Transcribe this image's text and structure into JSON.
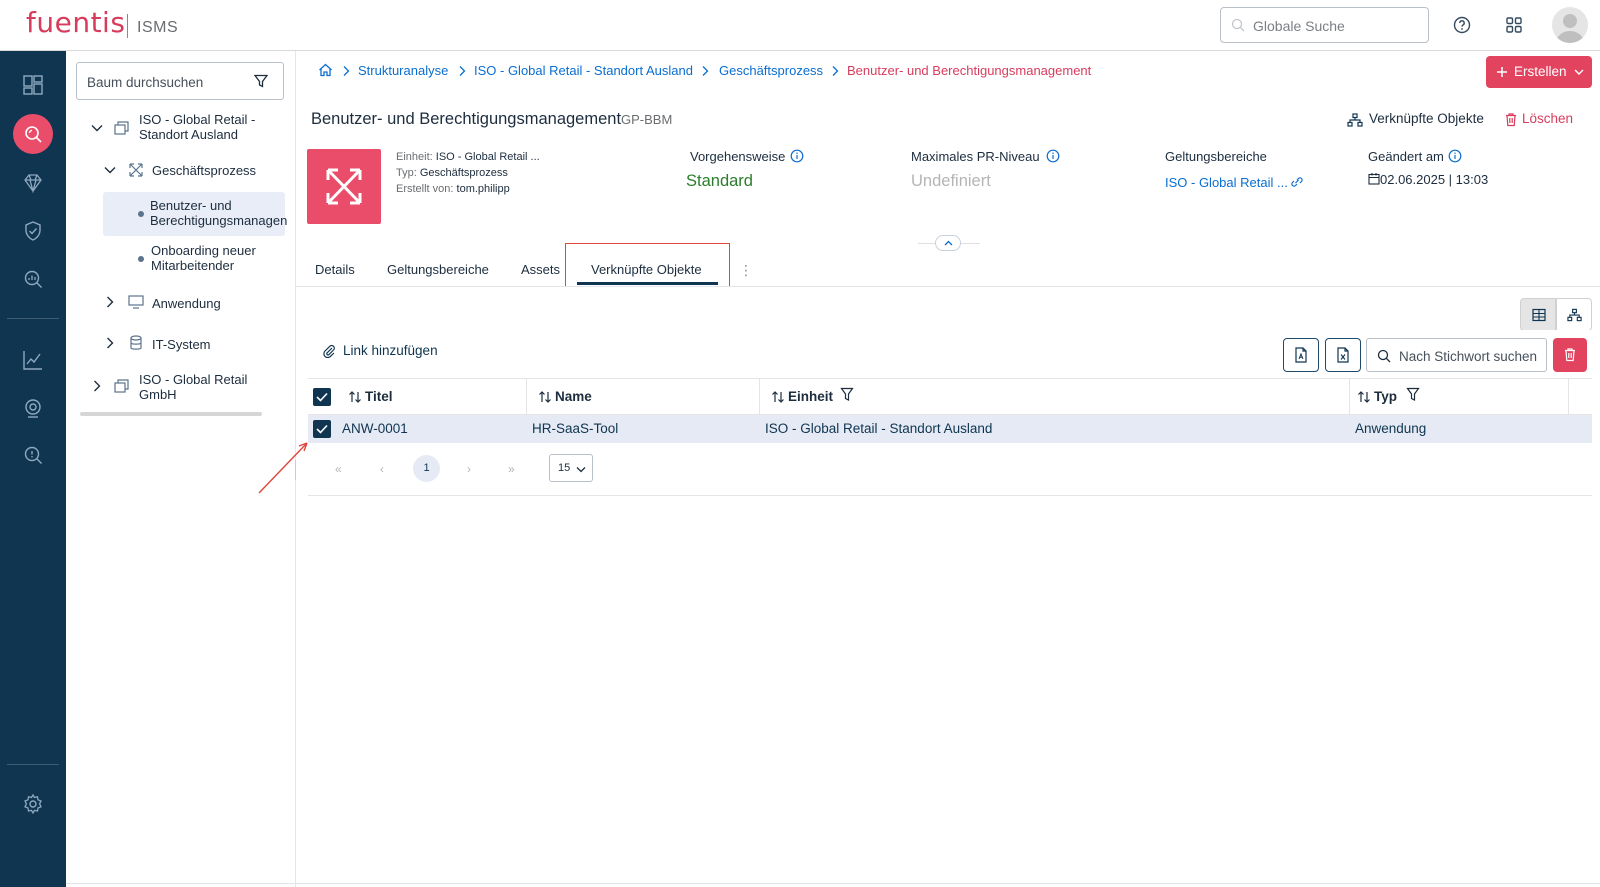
{
  "app": {
    "brand": "fuentis",
    "product": "ISMS"
  },
  "header": {
    "search_placeholder": "Globale Suche"
  },
  "sidenav": {
    "items": [
      "dashboard-icon",
      "search-scan-icon",
      "diamond-icon",
      "shield-check-icon",
      "search-chart-icon",
      "chart-line-icon",
      "target-icon",
      "search-alert-icon",
      "settings-icon"
    ]
  },
  "tree": {
    "search_placeholder": "Baum durchsuchen",
    "nodes": [
      {
        "label_1": "ISO - Global Retail -",
        "label_2": "Standort Ausland"
      },
      {
        "label": "Geschäftsprozess"
      },
      {
        "label_1": "Benutzer- und",
        "label_2": "Berechtigungsmanagen"
      },
      {
        "label_1": "Onboarding neuer",
        "label_2": "Mitarbeitender"
      },
      {
        "label": "Anwendung"
      },
      {
        "label": "IT-System"
      },
      {
        "label_1": "ISO - Global Retail",
        "label_2": "GmbH"
      }
    ]
  },
  "breadcrumb": [
    "Strukturanalyse",
    "ISO - Global Retail - Standort Ausland",
    "Geschäftsprozess",
    "Benutzer- und Berechtigungsmanagement"
  ],
  "actions": {
    "create_label": "Erstellen",
    "linked_objects_label": "Verknüpfte Objekte",
    "delete_label": "Löschen"
  },
  "object": {
    "title": "Benutzer- und Berechtigungsmanagement",
    "code": "GP-BBM",
    "unit_label": "Einheit:",
    "unit_value": "ISO - Global Retail ...",
    "type_label": "Typ:",
    "type_value": "Geschäftsprozess",
    "created_label": "Erstellt von:",
    "created_value": "tom.philipp",
    "approach_label": "Vorgehensweise",
    "approach_value": "Standard",
    "pr_label": "Maximales PR-Niveau",
    "pr_value": "Undefiniert",
    "scope_label": "Geltungsbereiche",
    "scope_value": "ISO - Global Retail ...",
    "changed_label": "Geändert am",
    "changed_value": "02.06.2025 | 13:03"
  },
  "tabs": [
    "Details",
    "Geltungsbereiche",
    "Assets",
    "Verknüpfte Objekte"
  ],
  "active_tab": "Verknüpfte Objekte",
  "table": {
    "link_add_label": "Link hinzufügen",
    "search_placeholder": "Nach Stichwort suchen",
    "columns": [
      "Titel",
      "Name",
      "Einheit",
      "Typ"
    ],
    "rows": [
      {
        "titel": "ANW-0001",
        "name": "HR-SaaS-Tool",
        "einheit": "ISO - Global Retail - Standort Ausland",
        "typ": "Anwendung",
        "selected": true
      }
    ],
    "pagination": {
      "current": "1",
      "page_size": "15",
      "first": "«",
      "prev": "‹",
      "next": "›",
      "last": "»"
    }
  },
  "colors": {
    "brand": "#d83c5c",
    "nav": "#0f3550",
    "accent": "#ea4d6a",
    "link": "#0a6ed1",
    "success": "#2b7d2b"
  }
}
